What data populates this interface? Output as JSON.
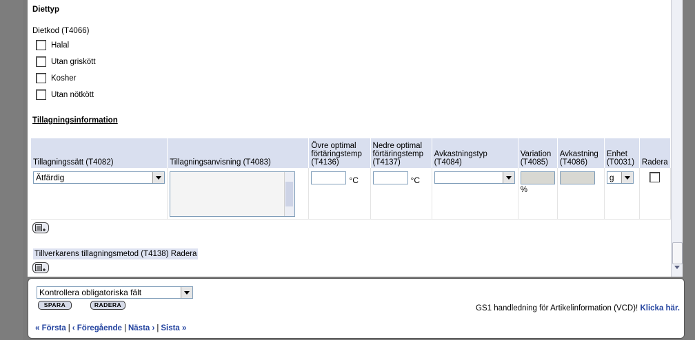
{
  "diet": {
    "section_title": "Diettyp",
    "code_label": "Dietkod (T4066)",
    "options": [
      "Halal",
      "Utan griskött",
      "Kosher",
      "Utan nötkött"
    ]
  },
  "prep": {
    "section_title": "Tillagningsinformation",
    "headers": {
      "method": "Tillagningssätt (T4082)",
      "instructions": "Tillagningsanvisning (T4083)",
      "max_temp": "Övre optimal förtäringstemp (T4136)",
      "min_temp": "Nedre optimal förtäringstemp (T4137)",
      "yield_type": "Avkastningstyp (T4084)",
      "variation": "Variation (T4085)",
      "yield": "Avkastning (T4086)",
      "unit": "Enhet (T0031)",
      "delete": "Radera"
    },
    "row": {
      "method_value": "Ätfärdig",
      "temp_unit": "°C",
      "variation_unit": "%",
      "unit_value": "g"
    },
    "manufacturer_label": "Tillverkarens tillagningsmetod (T4138)",
    "manufacturer_delete": "Radera"
  },
  "footer": {
    "check_select": "Kontrollera obligatoriska fält",
    "save": "SPARA",
    "delete": "RADERA",
    "help_text": "GS1 handledning för Artikelinformation (VCD)!",
    "help_link": "Klicka här.",
    "nav_first": "« Första",
    "nav_prev": "‹ Föregående",
    "nav_next": "Nästa ›",
    "nav_last": "Sista »"
  }
}
